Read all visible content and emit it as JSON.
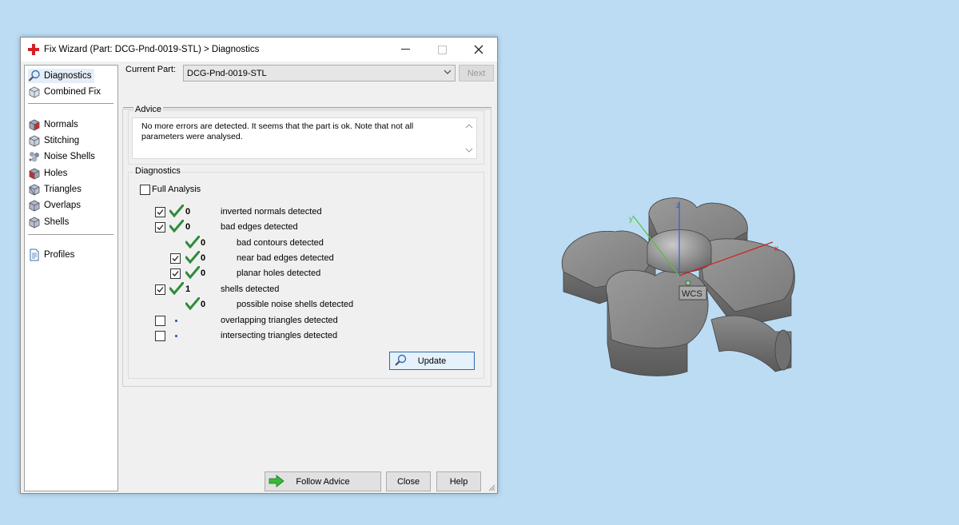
{
  "window": {
    "title": "Fix Wizard (Part: DCG-Pnd-0019-STL) > Diagnostics"
  },
  "sidebar": {
    "items": [
      {
        "label": "Diagnostics",
        "icon": "magnifier-icon"
      },
      {
        "label": "Combined Fix",
        "icon": "cube-icon"
      },
      {
        "label": "Normals",
        "icon": "cube-red-icon"
      },
      {
        "label": "Stitching",
        "icon": "cube-icon"
      },
      {
        "label": "Noise Shells",
        "icon": "noise-icon"
      },
      {
        "label": "Holes",
        "icon": "cube-red-icon"
      },
      {
        "label": "Triangles",
        "icon": "cube-icon"
      },
      {
        "label": "Overlaps",
        "icon": "cube-icon"
      },
      {
        "label": "Shells",
        "icon": "cube-icon"
      },
      {
        "label": "Profiles",
        "icon": "document-icon"
      }
    ]
  },
  "current_part": {
    "label": "Current Part:",
    "value": "DCG-Pnd-0019-STL",
    "next_label": "Next"
  },
  "advice": {
    "title": "Advice",
    "text": "No more errors are detected. It seems that the part is ok. Note that not all parameters were analysed."
  },
  "diagnostics": {
    "title": "Diagnostics",
    "full_analysis_label": "Full Analysis",
    "rows": [
      {
        "label": "inverted normals detected",
        "count": "0",
        "checkbox": true,
        "checked": true,
        "status": "ok"
      },
      {
        "label": "bad edges detected",
        "count": "0",
        "checkbox": true,
        "checked": true,
        "status": "ok"
      },
      {
        "label": "bad contours detected",
        "count": "0",
        "checkbox": false,
        "checked": false,
        "status": "ok"
      },
      {
        "label": "near bad edges detected",
        "count": "0",
        "checkbox": true,
        "checked": true,
        "status": "ok"
      },
      {
        "label": "planar holes detected",
        "count": "0",
        "checkbox": true,
        "checked": true,
        "status": "ok"
      },
      {
        "label": "shells detected",
        "count": "1",
        "checkbox": true,
        "checked": true,
        "status": "ok"
      },
      {
        "label": "possible noise shells detected",
        "count": "0",
        "checkbox": false,
        "checked": false,
        "status": "ok"
      },
      {
        "label": "overlapping triangles detected",
        "count": "",
        "checkbox": true,
        "checked": false,
        "status": "pending"
      },
      {
        "label": "intersecting triangles detected",
        "count": "",
        "checkbox": true,
        "checked": false,
        "status": "pending"
      }
    ],
    "update_label": "Update"
  },
  "buttons": {
    "follow_advice": "Follow Advice",
    "close": "Close",
    "help": "Help"
  },
  "viewport": {
    "wcs_label": "WCS",
    "axis_x": "x",
    "axis_y": "y",
    "axis_z": "z"
  },
  "colors": {
    "check_green": "#2e8b3a",
    "selection": "#e5eef8",
    "desktop": "#bcdcf4",
    "axis_x": "#d42020",
    "axis_y": "#55c040",
    "axis_z": "#3060d0"
  }
}
